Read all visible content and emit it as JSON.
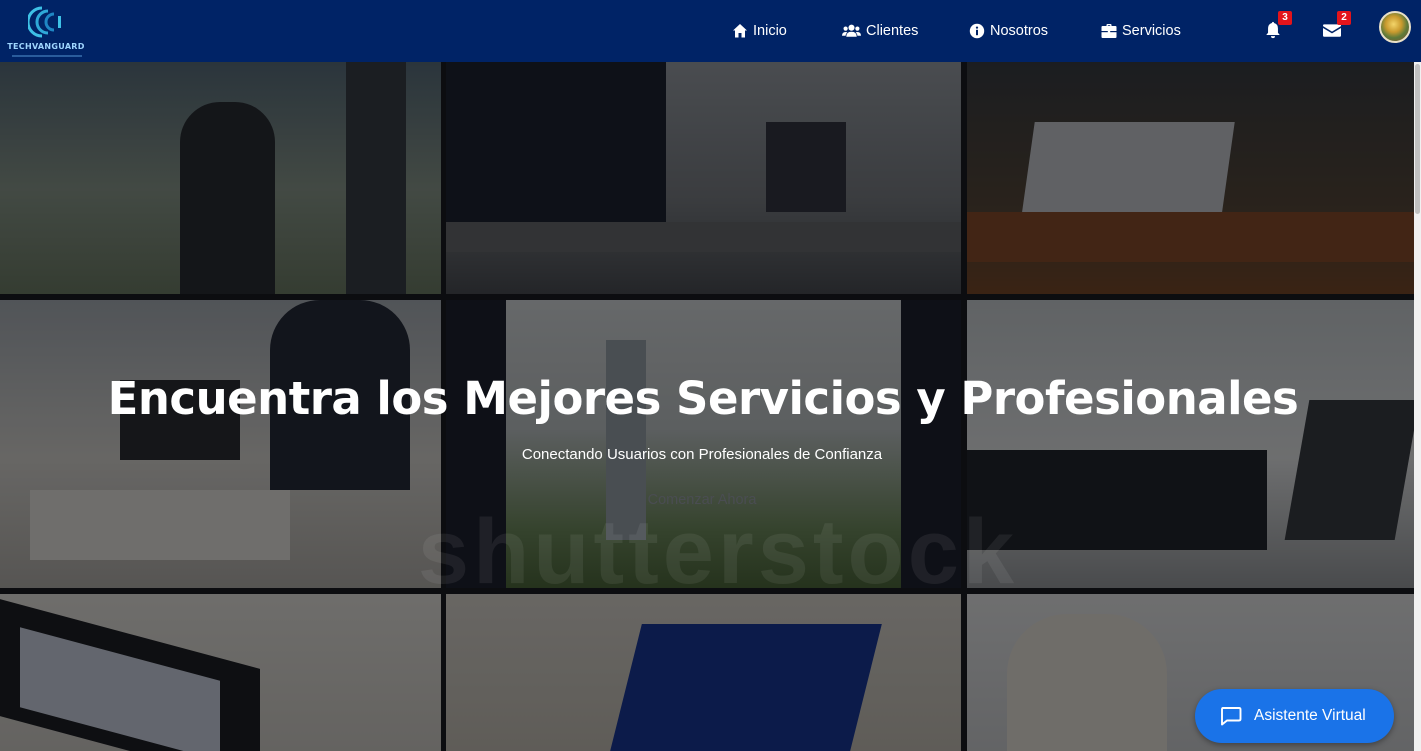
{
  "brand": {
    "name": "TECHVANGUARD"
  },
  "nav": {
    "items": [
      {
        "label": "Inicio",
        "icon": "home-icon"
      },
      {
        "label": "Clientes",
        "icon": "users-icon"
      },
      {
        "label": "Nosotros",
        "icon": "info-icon"
      },
      {
        "label": "Servicios",
        "icon": "briefcase-icon"
      }
    ],
    "notifications": {
      "icon": "bell-icon",
      "count": "3"
    },
    "messages": {
      "icon": "envelope-icon",
      "count": "2"
    },
    "avatar": {
      "icon": "user-avatar"
    }
  },
  "hero": {
    "title": "Encuentra los Mejores Servicios y Profesionales",
    "subtitle": "Conectando Usuarios con Profesionales de Confianza",
    "cta": "Comenzar Ahora",
    "watermark": "shutterstock"
  },
  "assistant": {
    "label": "Asistente Virtual",
    "icon": "chat-bubble-icon"
  },
  "colors": {
    "navbar": "#002366",
    "badge": "#e3141b",
    "assistant": "#1a73e8"
  }
}
